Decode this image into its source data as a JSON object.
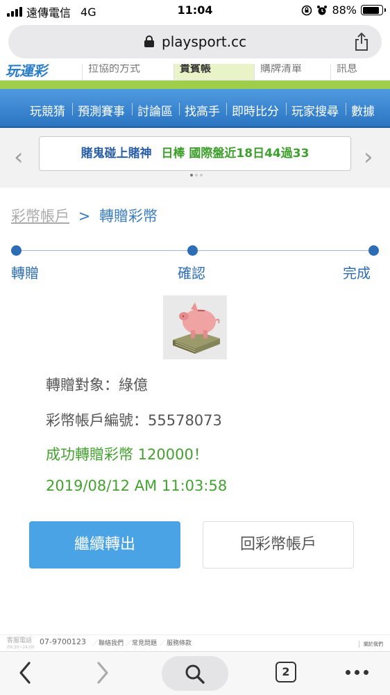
{
  "status_bar": {
    "carrier": "遠傳電信",
    "network": "4G",
    "time": "11:04",
    "battery": "88%",
    "battery_level": 0.88
  },
  "browser": {
    "url": "playsport.cc",
    "tab_count": "2"
  },
  "site_header": {
    "strip_items": [
      "拉協的方式",
      "貴賓帳",
      "購牌清單",
      "訊息"
    ]
  },
  "nav": {
    "items": [
      "玩競猜",
      "預測賽事",
      "討論區",
      "找高手",
      "即時比分",
      "玩家搜尋",
      "數據"
    ]
  },
  "ticker": {
    "part1": "賭鬼碰上賭神",
    "part2": "日棒 國際盤近18日44過33"
  },
  "breadcrumb": {
    "parent": "彩幣帳戶",
    "separator": ">",
    "current": "轉贈彩幣"
  },
  "steps": [
    "轉贈",
    "確認",
    "完成"
  ],
  "result": {
    "recipient": "轉贈對象：綠億",
    "account": "彩幣帳戶編號：55578073",
    "success": "成功轉贈彩幣 120000！",
    "timestamp": "2019/08/12 AM 11:03:58"
  },
  "buttons": {
    "continue": "繼續轉出",
    "back": "回彩幣帳戶"
  },
  "footer": {
    "service_label": "客服電話",
    "service_hours": "09:30~24:00",
    "phone": "07-9700123",
    "links": [
      "聯絡我們",
      "常見問題",
      "服務條款"
    ],
    "about": "關於我們"
  },
  "colors": {
    "nav_blue": "#2b74c2",
    "accent_blue": "#2c6db5",
    "success_green": "#43a22f",
    "button_blue": "#4aa3e5"
  }
}
